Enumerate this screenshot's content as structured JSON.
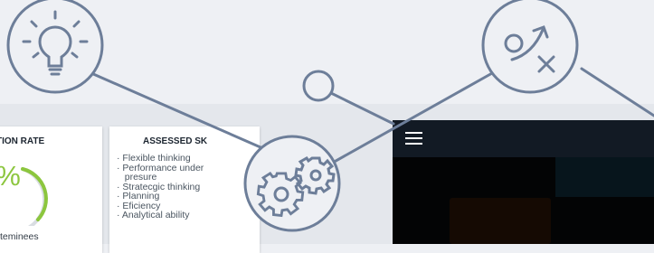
{
  "cards": {
    "rate": {
      "title": "TION RATE",
      "value": "9%",
      "value_fraction": 0.89,
      "caption": "teminees",
      "accent": "#8cc63e"
    },
    "skills": {
      "title": "ASSESSED SK",
      "items": [
        "· Flexible thinking",
        "· Performance under",
        "   presure",
        "· Stratecgic thinking",
        "· Planning",
        "· Eficiency",
        "· Analytical ability"
      ]
    }
  },
  "app": {
    "menu_icon": "hamburger-icon",
    "bar_color": "#121a24",
    "body_color": "#030405"
  },
  "icons": [
    "lightbulb-icon",
    "strategy-play-icon",
    "gears-icon",
    "connector-node-icon"
  ],
  "line_color": "#6d7e99"
}
